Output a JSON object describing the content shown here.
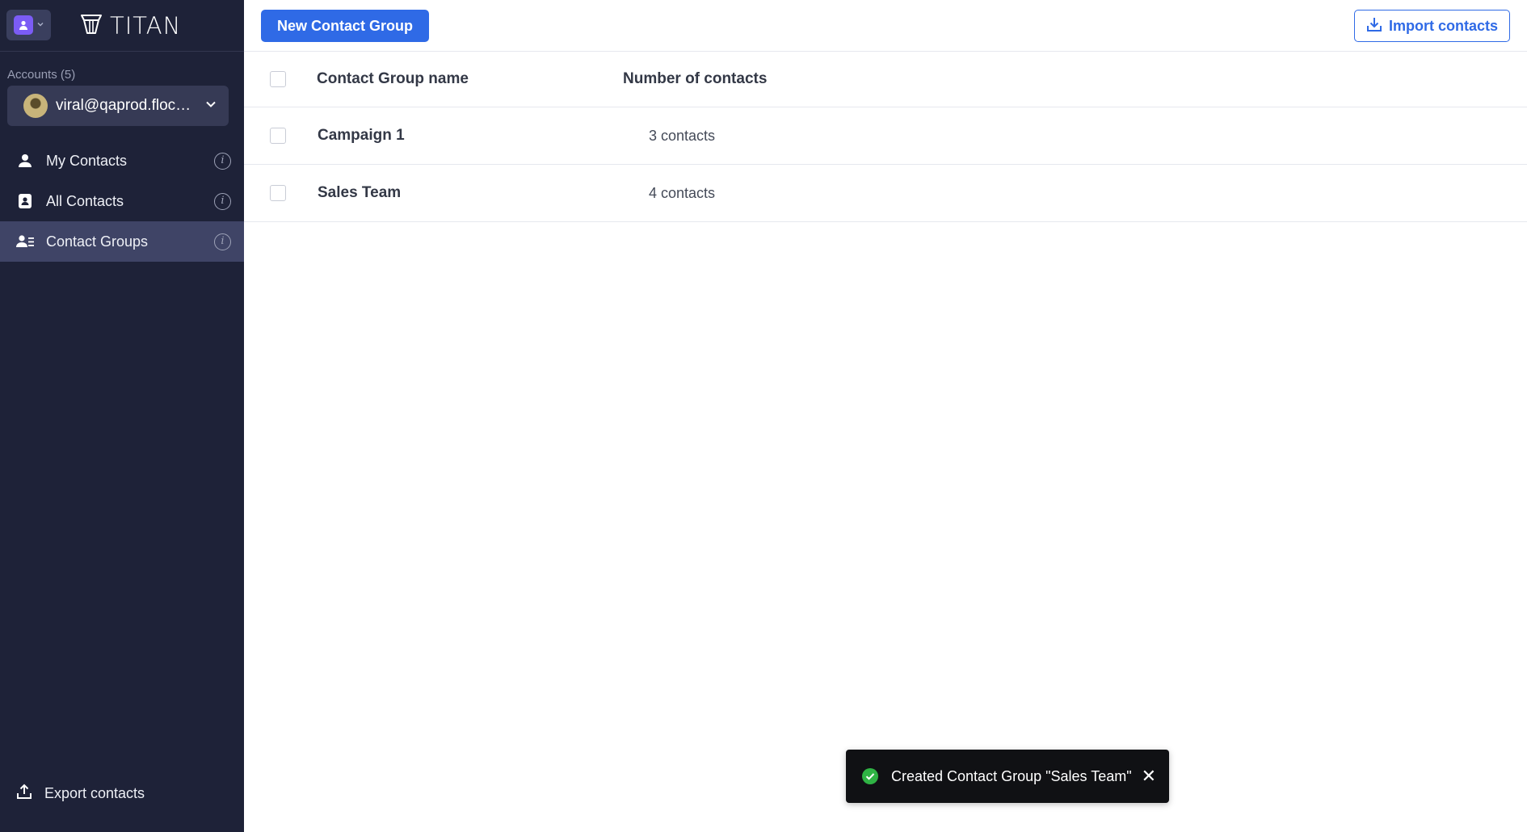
{
  "brand": {
    "name": "TITAN"
  },
  "sidebar": {
    "accounts_label": "Accounts (5)",
    "account_email": "viral@qaprod.flock.c...",
    "items": [
      {
        "label": "My Contacts",
        "icon": "user-icon",
        "active": false
      },
      {
        "label": "All Contacts",
        "icon": "contact-book-icon",
        "active": false
      },
      {
        "label": "Contact Groups",
        "icon": "contact-groups-icon",
        "active": true
      }
    ],
    "export_label": "Export contacts"
  },
  "toolbar": {
    "new_group_label": "New Contact Group",
    "import_label": "Import contacts"
  },
  "table": {
    "columns": [
      "Contact Group name",
      "Number of contacts"
    ],
    "rows": [
      {
        "name": "Campaign 1",
        "count": "3 contacts"
      },
      {
        "name": "Sales Team",
        "count": "4 contacts"
      }
    ]
  },
  "toast": {
    "message": "Created Contact Group \"Sales Team\"",
    "close_glyph": "✕"
  },
  "colors": {
    "sidebar_bg": "#1e2238",
    "active_item_bg": "#3f4466",
    "primary": "#2f6ae6",
    "toast_bg": "#101114",
    "success": "#2fb344",
    "app_icon": "#7b5cf5"
  }
}
